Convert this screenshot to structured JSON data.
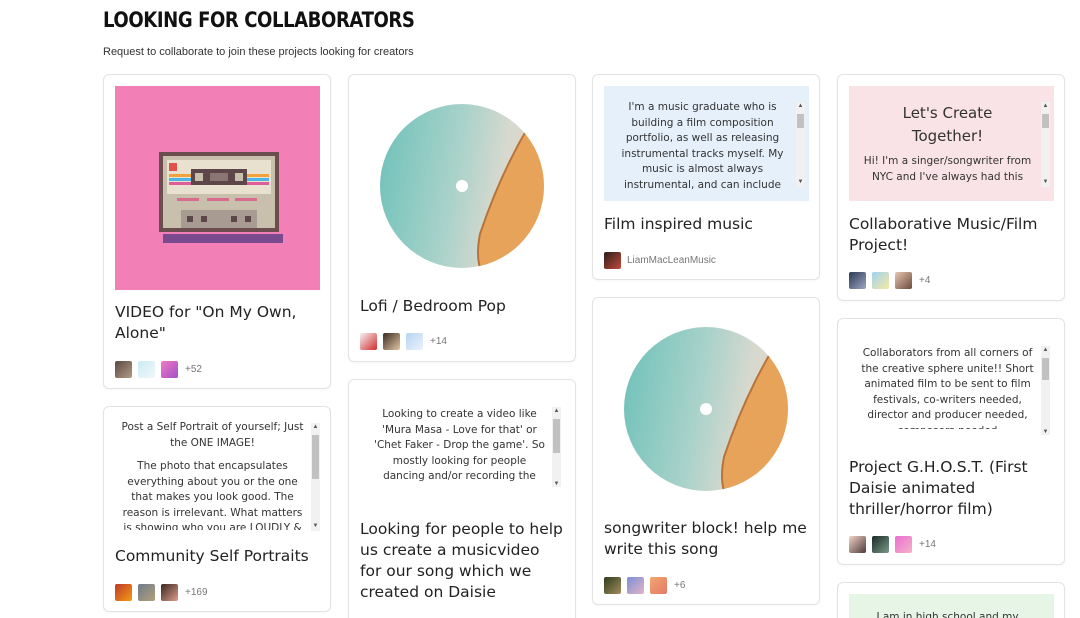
{
  "header": {
    "title": "LOOKING FOR COLLABORATORS",
    "subtitle": "Request to collaborate to join these projects looking for creators"
  },
  "cards": {
    "video_on_my_own": {
      "title": "VIDEO for \"On My Own, Alone\"",
      "more": "+52"
    },
    "lofi": {
      "title": "Lofi / Bedroom Pop",
      "more": "+14"
    },
    "film_music": {
      "description": "I'm a music graduate who is building a film composition portfolio, as well as releasing instrumental tracks myself. My music is almost always instrumental, and can include",
      "title": "Film inspired music",
      "owner": "LiamMacLeanMusic"
    },
    "collab_music_film": {
      "heading": "Let's Create Together!",
      "description": "Hi! I'm a singer/songwriter from NYC and I've always had this",
      "title": "Collaborative Music/Film Project!",
      "more": "+4"
    },
    "self_portrait": {
      "description_1": "Post a Self Portrait of yourself; Just the ONE IMAGE!",
      "description_2": "The photo that encapsulates everything about you or the one that makes you look good. The reason is irrelevant. What matters is showing who you are LOUDLY & PROUDLY",
      "title": "Community Self Portraits",
      "more": "+169"
    },
    "musicvideo": {
      "description": "Looking to create a video like 'Mura Masa - Love for that' or 'Chet Faker - Drop the game'. So mostly looking for people dancing and/or recording the video",
      "title": "Looking for people to help us create a musicvideo for our song which we created on Daisie"
    },
    "songwriter_block": {
      "title": "songwriter block! help me write this song",
      "more": "+6"
    },
    "ghost": {
      "description": "Collaborators from all corners of the creative sphere unite!! Short animated film to be sent to film festivals, co-writers needed, director and producer needed, composers needed",
      "title": "Project G.H.O.S.T. (First Daisie animated thriller/horror film)",
      "more": "+14"
    },
    "high_school": {
      "description": "I am in high school and my"
    }
  },
  "colors": {
    "cassette_bg": "#f27fb5",
    "film_box_bg": "#e6f0fb",
    "collab_box_bg": "#f9e3e6",
    "highschool_box_bg": "#e6f5e6"
  },
  "icons": {
    "cassette": "cassette-tape-icon",
    "disc": "vinyl-disc-icon"
  }
}
